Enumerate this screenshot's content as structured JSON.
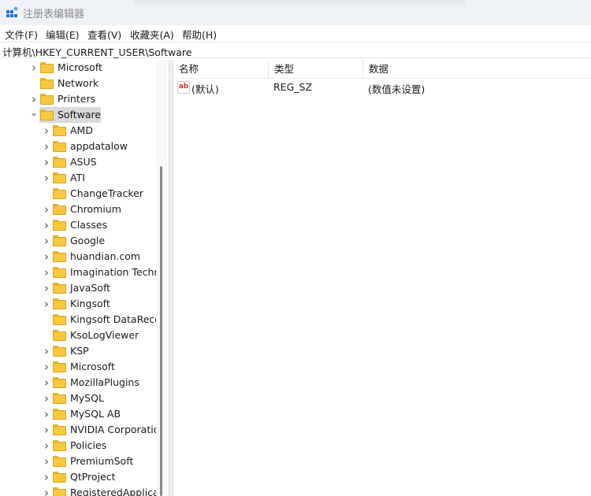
{
  "window": {
    "title": "注册表编辑器"
  },
  "menu": {
    "items": [
      {
        "label": "文件(F)"
      },
      {
        "label": "编辑(E)"
      },
      {
        "label": "查看(V)"
      },
      {
        "label": "收藏夹(A)"
      },
      {
        "label": "帮助(H)"
      }
    ]
  },
  "address": {
    "path": "计算机\\HKEY_CURRENT_USER\\Software"
  },
  "tree": {
    "items": [
      {
        "label": "Microsoft",
        "level": 1,
        "expander": "collapsed"
      },
      {
        "label": "Network",
        "level": 1,
        "expander": "none"
      },
      {
        "label": "Printers",
        "level": 1,
        "expander": "collapsed"
      },
      {
        "label": "Software",
        "level": 1,
        "expander": "expanded",
        "selected": true
      },
      {
        "label": "AMD",
        "level": 2,
        "expander": "collapsed"
      },
      {
        "label": "appdatalow",
        "level": 2,
        "expander": "collapsed"
      },
      {
        "label": "ASUS",
        "level": 2,
        "expander": "collapsed"
      },
      {
        "label": "ATI",
        "level": 2,
        "expander": "collapsed"
      },
      {
        "label": "ChangeTracker",
        "level": 2,
        "expander": "none"
      },
      {
        "label": "Chromium",
        "level": 2,
        "expander": "collapsed"
      },
      {
        "label": "Classes",
        "level": 2,
        "expander": "collapsed"
      },
      {
        "label": "Google",
        "level": 2,
        "expander": "collapsed"
      },
      {
        "label": "huandian.com",
        "level": 2,
        "expander": "collapsed"
      },
      {
        "label": "Imagination Techn",
        "level": 2,
        "expander": "collapsed"
      },
      {
        "label": "JavaSoft",
        "level": 2,
        "expander": "collapsed"
      },
      {
        "label": "Kingsoft",
        "level": 2,
        "expander": "collapsed"
      },
      {
        "label": "Kingsoft DataReco",
        "level": 2,
        "expander": "none"
      },
      {
        "label": "KsoLogViewer",
        "level": 2,
        "expander": "none"
      },
      {
        "label": "KSP",
        "level": 2,
        "expander": "collapsed"
      },
      {
        "label": "Microsoft",
        "level": 2,
        "expander": "collapsed"
      },
      {
        "label": "MozillaPlugins",
        "level": 2,
        "expander": "collapsed"
      },
      {
        "label": "MySQL",
        "level": 2,
        "expander": "collapsed"
      },
      {
        "label": "MySQL AB",
        "level": 2,
        "expander": "collapsed"
      },
      {
        "label": "NVIDIA Corporatio",
        "level": 2,
        "expander": "collapsed"
      },
      {
        "label": "Policies",
        "level": 2,
        "expander": "collapsed"
      },
      {
        "label": "PremiumSoft",
        "level": 2,
        "expander": "collapsed"
      },
      {
        "label": "QtProject",
        "level": 2,
        "expander": "collapsed"
      },
      {
        "label": "RegisteredApplica",
        "level": 2,
        "expander": "collapsed"
      }
    ]
  },
  "list": {
    "columns": [
      {
        "label": "名称"
      },
      {
        "label": "类型"
      },
      {
        "label": "数据"
      }
    ],
    "rows": [
      {
        "name": "(默认)",
        "type": "REG_SZ",
        "data": "(数值未设置)",
        "icon": "ab"
      }
    ]
  },
  "colors": {
    "folder": "#f5c842",
    "selection": "#d9d9d9",
    "string_value_icon": "#d0362b"
  }
}
